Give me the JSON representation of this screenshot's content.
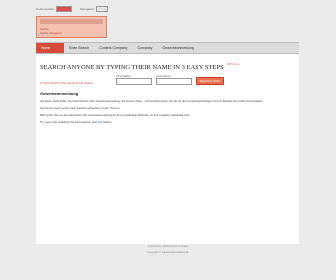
{
  "topbar": {
    "first_label": "Customerbox",
    "second_label": "Navigation"
  },
  "header": {
    "logo_text": "Suche",
    "subtext": "Suche eingeben"
  },
  "nav": {
    "items": [
      "Home",
      "Erste Search",
      "Content Company",
      "Company",
      "Gewerbeanmeldung"
    ]
  },
  "search": {
    "heading": "SEARCH ANYONE BY TYPING THEIR NAME IN 3 EASY STEPS",
    "hint": "100% free",
    "links_text": "1) Click Field 2) Set Fields 3) Hit Search",
    "first_name_label": "First Name",
    "last_name_label": "Last Name",
    "button_label": "SEARCH NOW"
  },
  "section": {
    "title": "Gewerbeanmeldung",
    "p1": "Auf dieser Seite finden Sie Informationen über Gewerbeanmeldung. Sie können diese - und die Dokumente, die Sie für die Anmeldung benötigen und zur Beispiel Formulare herunterladen.",
    "p2": "Sie können auch suchen nach weiteren Hinweisen zu den Themen.",
    "p3": "Bitte prüfen Sie vor dem Einreichen der Gewerbeanmeldung bei Ihrer zuständigen Behörde, ob Ihre Angaben vollständig sind.",
    "p4_prefix": "Tip: Lesen Sie unbedingt die Informationen über",
    "p4_link": "hier",
    "p4_suffix": "klicken."
  },
  "footer": {
    "line1": "Impressum | Datenschutz | Kontakt",
    "line2": "Copyright © Gewerbeanmeldung.de"
  }
}
